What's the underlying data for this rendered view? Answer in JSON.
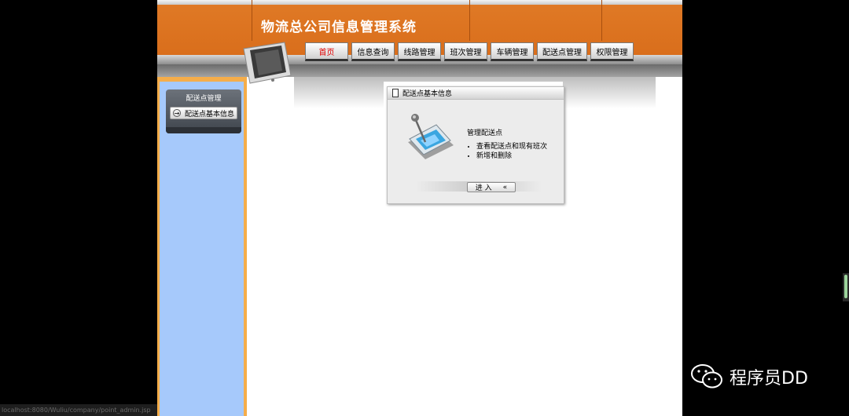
{
  "app": {
    "title": "物流总公司信息管理系统"
  },
  "nav": {
    "tabs": [
      {
        "label": "首页",
        "active": true
      },
      {
        "label": "信息查询"
      },
      {
        "label": "线路管理"
      },
      {
        "label": "班次管理"
      },
      {
        "label": "车辆管理"
      },
      {
        "label": "配送点管理"
      },
      {
        "label": "权限管理"
      }
    ]
  },
  "sidebar": {
    "title": "配送点管理",
    "items": [
      {
        "label": "配送点基本信息",
        "icon": "arrow-circle-icon"
      }
    ]
  },
  "card": {
    "title": "配送点基本信息",
    "heading": "管理配送点",
    "bullets": [
      "查看配送点和现有班次",
      "新增和删除"
    ],
    "enter_label": "进 入",
    "enter_suffix": "«"
  },
  "status": {
    "url": "localhost:8080/Wuliu/company/point_admin.jsp"
  },
  "watermark": {
    "text": "程序员DD"
  },
  "colors": {
    "header_orange": "#e07a26",
    "sidebar_blue": "#a6c9fb",
    "sidebar_border": "#f5ad4a",
    "active_tab_text": "#e00000"
  }
}
